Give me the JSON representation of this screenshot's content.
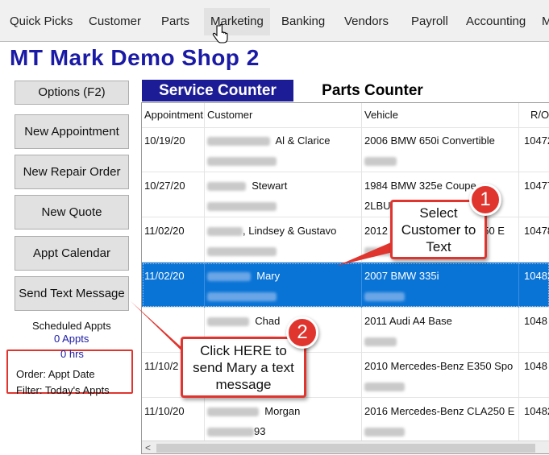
{
  "menu": {
    "items": [
      "Quick Picks",
      "Customer",
      "Parts",
      "Marketing",
      "Banking",
      "Vendors",
      "Payroll",
      "Accounting",
      "M"
    ]
  },
  "shop": {
    "title": "MT Mark Demo Shop 2"
  },
  "sidebar": {
    "buttons": [
      "Options (F2)",
      "New Appointment",
      "New Repair Order",
      "New Quote",
      "Appt Calendar",
      "Send Text Message"
    ],
    "scheduled_label": "Scheduled Appts",
    "appts_count": "0 Appts",
    "hours": "0 hrs",
    "order": "Order: Appt Date",
    "filter": "Filter: Today's Appts"
  },
  "tabs": {
    "service": "Service Counter",
    "parts": "Parts Counter"
  },
  "grid": {
    "columns": [
      "Appointment",
      "Customer",
      "Vehicle",
      "R/O"
    ],
    "rows": [
      {
        "date": "10/19/20",
        "customer": "Al & Clarice",
        "vehicle": "2006 BMW  650i Convertible",
        "ro": "10472",
        "vehicle2": ""
      },
      {
        "date": "10/27/20",
        "customer": "Stewart",
        "vehicle": "1984 BMW  325e Coupe",
        "ro": "10477",
        "vehicle2": "2LBU"
      },
      {
        "date": "11/02/20",
        "customer": ", Lindsey & Gustavo",
        "vehicle": "2012",
        "ro": "10478",
        "vehicle2": ""
      },
      {
        "date": "11/02/20",
        "customer": "Mary",
        "vehicle": "2007 BMW  335i",
        "ro": "10482",
        "vehicle2": ""
      },
      {
        "date": "",
        "customer": "Chad",
        "vehicle": "2011 Audi  A4 Base",
        "ro": "1048",
        "vehicle2": ""
      },
      {
        "date": "11/10/2",
        "customer": "",
        "vehicle": "2010 Mercedes-Benz  E350 Spo",
        "ro": "1048",
        "vehicle2": ""
      },
      {
        "date": "11/10/20",
        "customer": "Morgan",
        "vehicle": "2016 Mercedes-Benz  CLA250 E",
        "ro": "10482",
        "vehicle2": ""
      }
    ],
    "partial_vehicle_text": "350 E",
    "partial_phone_text": "93",
    "scroll_left": "<"
  },
  "callouts": {
    "one": {
      "number": "1",
      "text": "Select Customer to Text"
    },
    "two": {
      "number": "2",
      "text": "Click HERE to send Mary a text message"
    }
  },
  "colors": {
    "accent_red": "#e0352f",
    "title_blue": "#1a1aa6",
    "tab_blue": "#1c1c96",
    "selected_row": "#0a74d6"
  }
}
